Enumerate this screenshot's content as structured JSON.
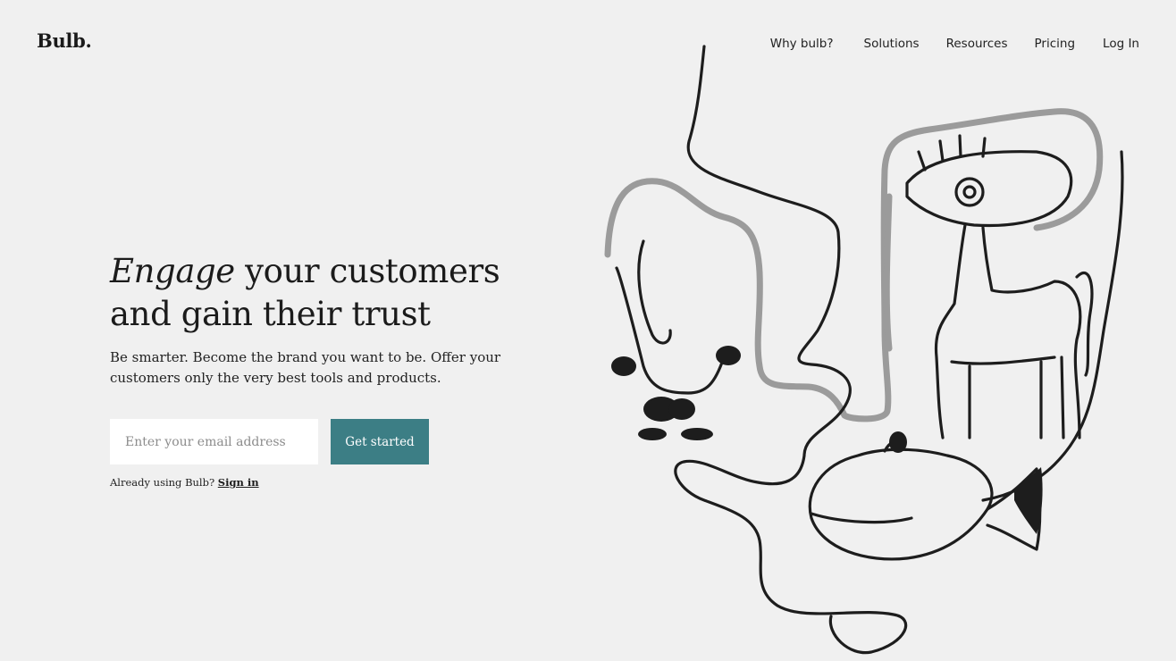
{
  "header": {
    "logo": "Bulb.",
    "nav": [
      "Why bulb?",
      "Solutions",
      "Resources",
      "Pricing",
      "Log In"
    ]
  },
  "hero": {
    "title_em": "Engage",
    "title_rest_1": " your customers",
    "title_rest_2": "and gain their trust",
    "subtitle": "Be smarter. Become the brand you want to be. Offer your customers only the very best tools and products.",
    "email_placeholder": "Enter your email address",
    "cta_label": "Get started",
    "signin_prefix": "Already using Bulb?",
    "signin_link": "Sign in"
  },
  "colors": {
    "background": "#f0f0f0",
    "accent": "#3c7e85",
    "text": "#1b1b1b"
  }
}
